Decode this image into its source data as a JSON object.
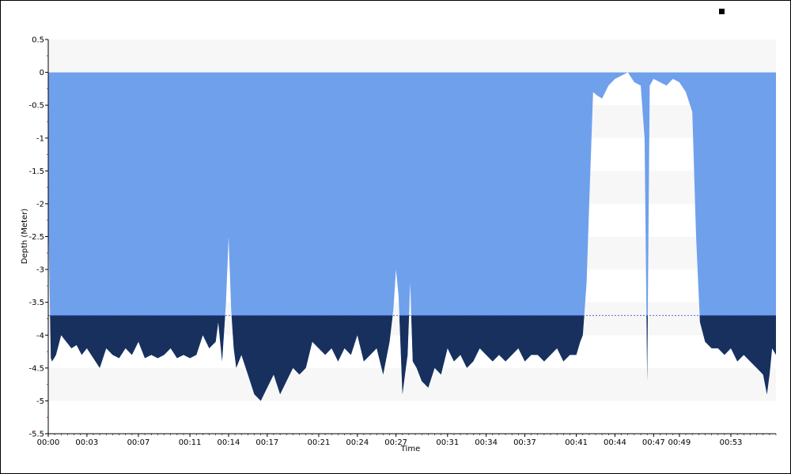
{
  "chart_data": {
    "type": "area",
    "xlabel": "Time",
    "ylabel": "Depth (Meter)",
    "xlim_minutes": [
      0,
      56.5
    ],
    "ylim": [
      -5.5,
      0.5
    ],
    "grid": "horizontal bands",
    "x_ticks": [
      "00:00",
      "00:03",
      "00:07",
      "00:11",
      "00:14",
      "00:17",
      "00:21",
      "00:24",
      "00:27",
      "00:31",
      "00:34",
      "00:37",
      "00:41",
      "00:44",
      "00:47",
      "00:49",
      "00:53"
    ],
    "y_ticks": [
      "0.5",
      "0",
      "-0.5",
      "-1",
      "-1.5",
      "-2",
      "-2.5",
      "-3",
      "-3.5",
      "-4",
      "-4.5",
      "-5",
      "-5.5"
    ],
    "threshold_depth": -3.7,
    "colors": {
      "water": "#6fa0ec",
      "below_threshold": "#17305e",
      "band": "#f7f7f7",
      "threshold_line": "#4a55c8"
    },
    "series": [
      {
        "x": [
          0,
          0.2,
          0.3,
          0.6,
          1.0,
          1.4,
          1.8,
          2.2,
          2.6,
          3.0,
          3.5,
          4.0,
          4.5,
          5.0,
          5.5,
          6.0,
          6.5,
          7.0,
          7.5,
          8.0,
          8.5,
          9.0,
          9.5,
          10.0,
          10.5,
          11.0,
          11.5,
          12.0,
          12.5,
          13.0,
          13.2,
          13.5,
          13.8,
          14.0,
          14.2,
          14.4,
          14.6,
          15.0,
          15.5,
          16.0,
          16.5,
          17.0,
          17.5,
          18.0,
          18.5,
          19.0,
          19.5,
          20.0,
          20.5,
          21.0,
          21.5,
          22.0,
          22.5,
          23.0,
          23.5,
          24.0,
          24.5,
          25.0,
          25.5,
          26.0,
          26.5,
          26.8,
          27.0,
          27.2,
          27.5,
          27.7,
          27.9,
          28.1,
          28.3,
          28.6,
          29.0,
          29.5,
          30.0,
          30.5,
          31.0,
          31.5,
          32.0,
          32.5,
          33.0,
          33.5,
          34.0,
          34.5,
          35.0,
          35.5,
          36.0,
          36.5,
          37.0,
          37.5,
          38.0,
          38.5,
          39.0,
          39.5,
          40.0,
          40.5,
          41.0,
          41.3,
          41.5,
          41.8,
          42.0,
          42.3,
          42.6,
          43.0,
          43.5,
          44.0,
          44.5,
          45.0,
          45.5,
          46.0,
          46.3,
          46.5,
          46.7,
          47.0,
          47.5,
          48.0,
          48.5,
          49.0,
          49.5,
          50.0,
          50.3,
          50.6,
          51.0,
          51.5,
          52.0,
          52.5,
          53.0,
          53.5,
          54.0,
          54.5,
          55.0,
          55.5,
          55.8,
          56.0,
          56.2,
          56.5
        ],
        "y": [
          -2.2,
          -4.35,
          -4.4,
          -4.3,
          -4.0,
          -4.1,
          -4.2,
          -4.15,
          -4.3,
          -4.2,
          -4.35,
          -4.5,
          -4.2,
          -4.3,
          -4.35,
          -4.2,
          -4.3,
          -4.1,
          -4.35,
          -4.3,
          -4.35,
          -4.3,
          -4.2,
          -4.35,
          -4.3,
          -4.35,
          -4.3,
          -4.0,
          -4.2,
          -4.1,
          -3.8,
          -4.4,
          -3.5,
          -2.5,
          -3.6,
          -4.2,
          -4.5,
          -4.3,
          -4.6,
          -4.9,
          -5.0,
          -4.8,
          -4.6,
          -4.9,
          -4.7,
          -4.5,
          -4.6,
          -4.5,
          -4.1,
          -4.2,
          -4.3,
          -4.2,
          -4.4,
          -4.2,
          -4.3,
          -4.0,
          -4.4,
          -4.3,
          -4.2,
          -4.6,
          -4.1,
          -3.6,
          -3.0,
          -3.4,
          -4.9,
          -4.6,
          -4.3,
          -3.2,
          -4.4,
          -4.5,
          -4.7,
          -4.8,
          -4.5,
          -4.6,
          -4.2,
          -4.4,
          -4.3,
          -4.5,
          -4.4,
          -4.2,
          -4.3,
          -4.4,
          -4.3,
          -4.4,
          -4.3,
          -4.2,
          -4.4,
          -4.3,
          -4.3,
          -4.4,
          -4.3,
          -4.2,
          -4.4,
          -4.3,
          -4.3,
          -4.1,
          -4.0,
          -3.2,
          -2.0,
          -0.3,
          -0.35,
          -0.4,
          -0.2,
          -0.1,
          -0.05,
          0.0,
          -0.15,
          -0.2,
          -1.0,
          -4.7,
          -0.2,
          -0.1,
          -0.15,
          -0.2,
          -0.1,
          -0.15,
          -0.3,
          -0.6,
          -2.5,
          -3.8,
          -4.1,
          -4.2,
          -4.2,
          -4.3,
          -4.2,
          -4.4,
          -4.3,
          -4.4,
          -4.5,
          -4.6,
          -4.9,
          -4.6,
          -4.2,
          -4.3
        ]
      }
    ]
  }
}
